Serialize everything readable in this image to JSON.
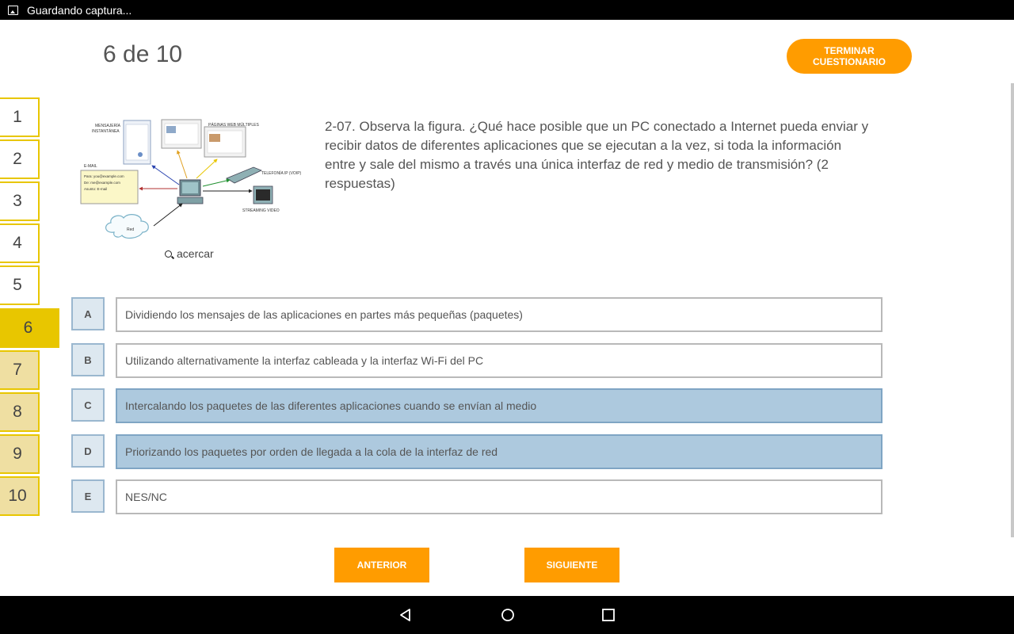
{
  "status_bar": {
    "text": "Guardando captura..."
  },
  "header": {
    "counter": "6 de 10",
    "finish_label": "TERMINAR CUESTIONARIO"
  },
  "question_nav": [
    "1",
    "2",
    "3",
    "4",
    "5",
    "6",
    "7",
    "8",
    "9",
    "10"
  ],
  "current_question": "6",
  "figure": {
    "labels": {
      "im": [
        "MENSAJERÍA",
        "INSTANTÁNEA"
      ],
      "web": "PÁGINAS WEB MÚLTIPLES",
      "email": "E-MAIL",
      "email_lines": [
        "Para: you@example.com",
        "De: me@example.com",
        "Asunto: E-mail"
      ],
      "voip": "TELEFONÍA IP (VOIP)",
      "video": "STREAMING VIDEO",
      "cloud": "Red"
    },
    "zoom_label": "acercar"
  },
  "question": {
    "text": "2-07. Observa la figura. ¿Qué hace posible que un PC conectado a Internet pueda enviar y recibir datos de diferentes aplicaciones que se ejecutan a la vez, si toda la información entre y sale del mismo a través una única interfaz de red y medio de transmisión? (2 respuestas)"
  },
  "options": [
    {
      "letter": "A",
      "text": "Dividiendo los mensajes de las aplicaciones en partes más pequeñas (paquetes)",
      "selected": false
    },
    {
      "letter": "B",
      "text": "Utilizando alternativamente la interfaz cableada y la interfaz Wi-Fi del PC",
      "selected": false
    },
    {
      "letter": "C",
      "text": "Intercalando los paquetes de las diferentes aplicaciones cuando se envían al medio",
      "selected": true
    },
    {
      "letter": "D",
      "text": "Priorizando los paquetes por orden de llegada a la cola de la interfaz de red",
      "selected": true
    },
    {
      "letter": "E",
      "text": "NES/NC",
      "selected": false
    }
  ],
  "footer": {
    "prev_label": "ANTERIOR",
    "next_label": "SIGUIENTE"
  },
  "colors": {
    "accent": "#ff9c00",
    "nav_yellow": "#e8c600",
    "selected": "#adc9de"
  },
  "android_nav": {
    "icons": [
      "back-icon",
      "home-icon",
      "recents-icon"
    ]
  }
}
